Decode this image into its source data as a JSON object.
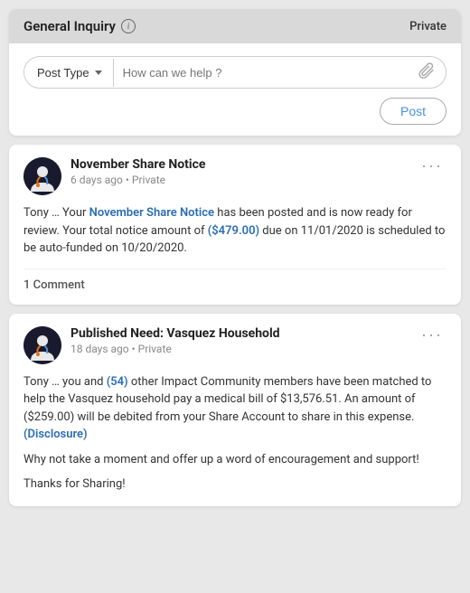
{
  "compose": {
    "header": {
      "title": "General Inquiry",
      "privacy": "Private"
    },
    "post_type_label": "Post Type",
    "placeholder": "How can we help ?",
    "post_button": "Post"
  },
  "feed": [
    {
      "id": "post-1",
      "title": "November Share Notice",
      "meta": "6 days ago • Private",
      "body_parts": [
        {
          "text": "Tony … Your ",
          "type": "normal"
        },
        {
          "text": "November Share Notice",
          "type": "link"
        },
        {
          "text": " has been posted and is now ready for review. Your total notice amount of ",
          "type": "normal"
        },
        {
          "text": "($479.00)",
          "type": "link"
        },
        {
          "text": " due on 11/01/2020 is scheduled to be auto-funded on 10/20/2020.",
          "type": "normal"
        }
      ],
      "footer": "1 Comment"
    },
    {
      "id": "post-2",
      "title": "Published Need: Vasquez Household",
      "meta": "18 days ago • Private",
      "body_parts": [
        {
          "text": "Tony … you and ",
          "type": "normal"
        },
        {
          "text": "(54)",
          "type": "link"
        },
        {
          "text": " other Impact Community members have been matched to help the Vasquez household pay a medical bill of $13,576.51. An amount of ($259.00) will be debited from your Share Account to share in this expense. ",
          "type": "normal"
        },
        {
          "text": "(Disclosure)",
          "type": "link"
        }
      ],
      "body_extra": [
        "Why not take a moment and offer up a word of encouragement and support!",
        "Thanks for Sharing!"
      ],
      "footer": ""
    }
  ]
}
